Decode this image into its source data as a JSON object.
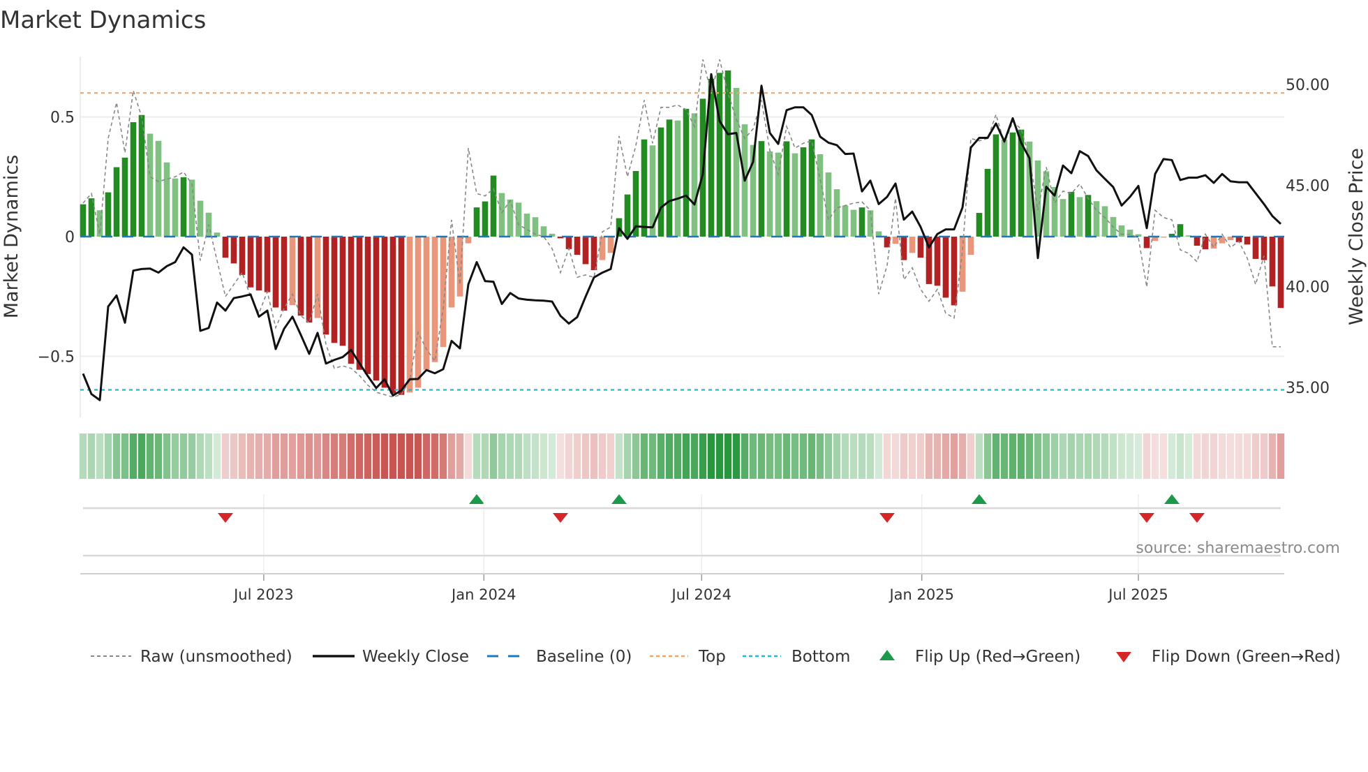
{
  "chart_data": {
    "type": "bar",
    "title": "Market Dynamics",
    "ylabel_left": "Market Dynamics",
    "ylabel_right": "Weekly Close Price",
    "source": "source: sharemaestro.com",
    "x_start": "2023-01-31",
    "x_step_days": 7,
    "ylim_left": [
      -0.75,
      0.75
    ],
    "ylim_right": [
      35,
      50
    ],
    "left_ticks": [
      {
        "v": 0.5,
        "label": "0.5"
      },
      {
        "v": 0,
        "label": "0"
      },
      {
        "v": -0.5,
        "label": "−0.5"
      }
    ],
    "right_ticks": [
      {
        "v": 50,
        "label": "50.00"
      },
      {
        "v": 45,
        "label": "45.00"
      },
      {
        "v": 40,
        "label": "40.00"
      },
      {
        "v": 35,
        "label": "35.00"
      }
    ],
    "x_ticks": [
      {
        "date": "2023-07-01",
        "label": "Jul 2023"
      },
      {
        "date": "2024-01-01",
        "label": "Jan 2024"
      },
      {
        "date": "2024-07-01",
        "label": "Jul 2024"
      },
      {
        "date": "2025-01-01",
        "label": "Jan 2025"
      },
      {
        "date": "2025-07-01",
        "label": "Jul 2025"
      }
    ],
    "top_level": 0.6,
    "bottom_level": -0.64,
    "baseline": 0,
    "values": [
      0.135,
      0.16,
      0.11,
      0.185,
      0.29,
      0.33,
      0.478,
      0.508,
      0.43,
      0.4,
      0.31,
      0.243,
      0.248,
      0.238,
      0.15,
      0.1,
      0.017,
      -0.088,
      -0.112,
      -0.16,
      -0.212,
      -0.225,
      -0.232,
      -0.296,
      -0.309,
      -0.286,
      -0.33,
      -0.359,
      -0.34,
      -0.409,
      -0.444,
      -0.456,
      -0.531,
      -0.556,
      -0.574,
      -0.601,
      -0.631,
      -0.655,
      -0.661,
      -0.651,
      -0.631,
      -0.556,
      -0.524,
      -0.461,
      -0.296,
      -0.25,
      -0.028,
      0.122,
      0.147,
      0.255,
      0.182,
      0.155,
      0.142,
      0.096,
      0.081,
      0.043,
      0.012,
      -0.007,
      -0.052,
      -0.076,
      -0.115,
      -0.14,
      -0.098,
      -0.068,
      0.077,
      0.176,
      0.274,
      0.406,
      0.381,
      0.456,
      0.489,
      0.485,
      0.534,
      0.515,
      0.576,
      0.659,
      0.684,
      0.694,
      0.621,
      0.469,
      0.383,
      0.399,
      0.356,
      0.351,
      0.398,
      0.348,
      0.373,
      0.406,
      0.344,
      0.268,
      0.198,
      0.13,
      0.112,
      0.122,
      0.11,
      0.022,
      -0.045,
      -0.03,
      -0.098,
      -0.068,
      -0.088,
      -0.198,
      -0.205,
      -0.255,
      -0.287,
      -0.23,
      -0.076,
      0.099,
      0.283,
      0.427,
      0.405,
      0.435,
      0.447,
      0.397,
      0.318,
      0.273,
      0.207,
      0.157,
      0.187,
      0.165,
      0.174,
      0.148,
      0.127,
      0.082,
      0.047,
      0.029,
      0.01,
      -0.048,
      -0.018,
      -0.004,
      0.012,
      0.052,
      0.005,
      -0.038,
      -0.053,
      -0.05,
      -0.028,
      -0.015,
      -0.023,
      -0.033,
      -0.093,
      -0.098,
      -0.208,
      -0.298
    ],
    "raw": [
      0.14,
      0.18,
      0.01,
      0.41,
      0.56,
      0.35,
      0.61,
      0.5,
      0.25,
      0.23,
      0.24,
      0.25,
      0.27,
      0.22,
      -0.1,
      0.05,
      -0.1,
      -0.25,
      -0.2,
      -0.15,
      -0.25,
      -0.32,
      -0.23,
      -0.38,
      -0.3,
      -0.24,
      -0.33,
      -0.36,
      -0.24,
      -0.45,
      -0.55,
      -0.54,
      -0.55,
      -0.58,
      -0.62,
      -0.65,
      -0.66,
      -0.67,
      -0.66,
      -0.6,
      -0.4,
      -0.47,
      -0.52,
      -0.3,
      0.07,
      -0.2,
      0.37,
      0.18,
      0.17,
      0.2,
      0.1,
      0.15,
      0.05,
      0.03,
      0.01,
      0.0,
      -0.05,
      -0.15,
      -0.05,
      -0.17,
      -0.16,
      -0.17,
      0.02,
      0.04,
      0.42,
      0.25,
      0.38,
      0.57,
      0.39,
      0.54,
      0.54,
      0.55,
      0.53,
      0.46,
      0.74,
      0.6,
      0.74,
      0.6,
      0.49,
      0.41,
      0.45,
      0.57,
      0.36,
      0.26,
      0.46,
      0.37,
      0.39,
      0.4,
      0.24,
      0.07,
      0.12,
      0.13,
      0.14,
      0.145,
      0.11,
      -0.24,
      -0.12,
      0.16,
      -0.18,
      -0.13,
      -0.22,
      -0.27,
      -0.22,
      -0.32,
      -0.34,
      -0.06,
      0.41,
      0.4,
      0.41,
      0.51,
      0.39,
      0.48,
      0.45,
      0.33,
      0.11,
      0.29,
      0.14,
      0.19,
      0.18,
      0.22,
      0.16,
      0.11,
      0.08,
      0.04,
      0.01,
      0.01,
      -0.005,
      -0.21,
      0.11,
      0.08,
      0.07,
      -0.055,
      -0.07,
      -0.105,
      0.01,
      -0.045,
      0.01,
      -0.045,
      -0.02,
      -0.09,
      -0.2,
      -0.08,
      -0.46,
      -0.46
    ],
    "close": [
      35.68,
      34.67,
      34.37,
      39.0,
      39.55,
      38.2,
      40.78,
      40.86,
      40.88,
      40.68,
      41.0,
      41.2,
      41.93,
      41.57,
      37.8,
      37.94,
      39.2,
      38.8,
      39.42,
      39.5,
      39.6,
      38.5,
      38.8,
      36.9,
      37.9,
      38.5,
      37.6,
      36.66,
      37.7,
      36.18,
      36.36,
      36.5,
      36.85,
      36.2,
      35.56,
      34.97,
      35.4,
      34.6,
      34.85,
      35.4,
      35.42,
      35.86,
      35.7,
      35.9,
      37.3,
      36.93,
      40.1,
      41.2,
      40.26,
      40.23,
      39.13,
      39.67,
      39.4,
      39.34,
      39.31,
      39.29,
      39.25,
      38.54,
      38.16,
      38.48,
      39.49,
      40.44,
      40.68,
      40.86,
      42.88,
      42.35,
      42.97,
      42.94,
      42.92,
      43.9,
      44.22,
      44.34,
      44.49,
      44.05,
      45.56,
      50.5,
      48.18,
      47.53,
      47.59,
      45.23,
      46.16,
      49.93,
      47.59,
      47.05,
      48.72,
      48.86,
      48.86,
      48.48,
      47.41,
      47.11,
      46.99,
      46.55,
      46.57,
      44.7,
      45.23,
      44.07,
      44.43,
      45.09,
      43.3,
      43.7,
      42.94,
      41.93,
      42.59,
      42.82,
      42.82,
      43.9,
      46.87,
      47.35,
      47.35,
      48.06,
      47.17,
      48.32,
      47.11,
      46.34,
      41.4,
      44.93,
      44.49,
      45.98,
      45.6,
      46.69,
      46.45,
      45.74,
      45.32,
      44.91,
      44.0,
      44.43,
      44.97,
      42.88,
      45.56,
      46.3,
      46.25,
      45.26,
      45.38,
      45.38,
      45.5,
      45.12,
      45.56,
      45.2,
      45.15,
      45.15,
      44.61,
      44.07,
      43.48,
      43.09
    ],
    "legend": {
      "placement": "bottom",
      "items": [
        {
          "key": "raw",
          "label": "Raw (unsmoothed)"
        },
        {
          "key": "close",
          "label": "Weekly Close"
        },
        {
          "key": "baseline",
          "label": "Baseline (0)"
        },
        {
          "key": "top",
          "label": "Top"
        },
        {
          "key": "bottom",
          "label": "Bottom"
        },
        {
          "key": "flip_up",
          "label": "Flip Up (Red→Green)"
        },
        {
          "key": "flip_down",
          "label": "Flip Down (Green→Red)"
        }
      ]
    },
    "colors": {
      "green_strong": "#228b22",
      "green_weak": "#80c080",
      "red_strong": "#b22222",
      "red_weak": "#e9967a",
      "raw": "#888888",
      "close": "#111111",
      "baseline": "#1f77b4",
      "top": "#f4a460",
      "bottom": "#17becf",
      "flip_up": "#1a9a4a",
      "flip_down": "#d62728"
    }
  }
}
